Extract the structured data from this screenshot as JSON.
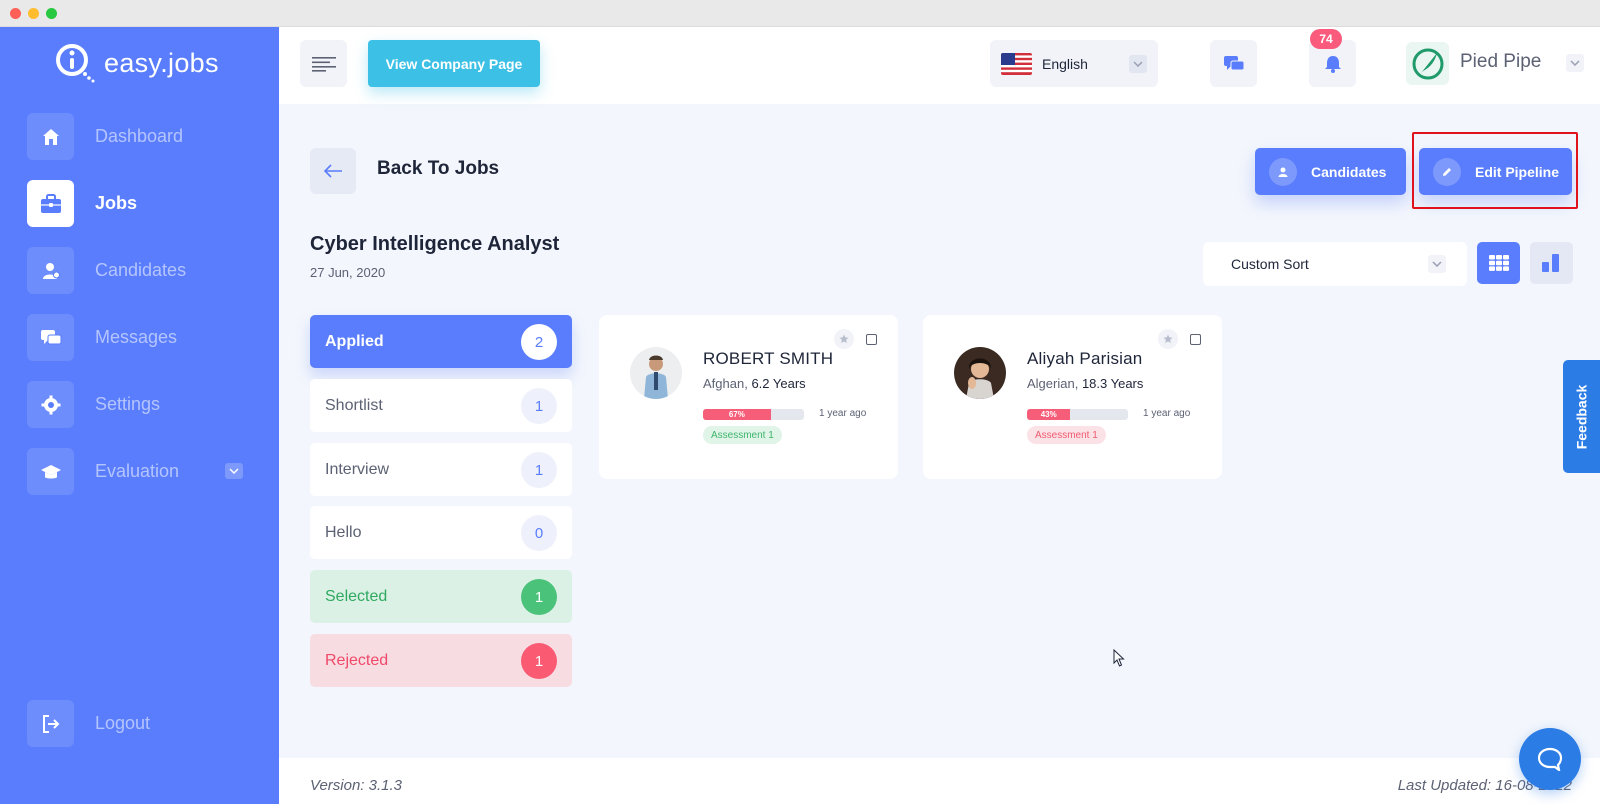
{
  "brand": {
    "name": "easy.jobs"
  },
  "sidebar": {
    "items": [
      {
        "label": "Dashboard",
        "icon": "home-icon"
      },
      {
        "label": "Jobs",
        "icon": "briefcase-icon",
        "active": true
      },
      {
        "label": "Candidates",
        "icon": "user-icon"
      },
      {
        "label": "Messages",
        "icon": "chat-icon"
      },
      {
        "label": "Settings",
        "icon": "gear-icon"
      },
      {
        "label": "Evaluation",
        "icon": "graduation-cap-icon"
      }
    ],
    "logout": "Logout"
  },
  "topbar": {
    "view_company_label": "View Company Page",
    "language": "English",
    "notification_count": "74",
    "company_name": "Pied Pipe"
  },
  "header": {
    "back_label": "Back To Jobs",
    "candidates_label": "Candidates",
    "edit_pipeline_label": "Edit Pipeline"
  },
  "job": {
    "title": "Cyber Intelligence Analyst",
    "date": "27 Jun, 2020"
  },
  "sort": {
    "selected": "Custom Sort"
  },
  "stages": [
    {
      "label": "Applied",
      "count": "2"
    },
    {
      "label": "Shortlist",
      "count": "1"
    },
    {
      "label": "Interview",
      "count": "1"
    },
    {
      "label": "Hello",
      "count": "0"
    },
    {
      "label": "Selected",
      "count": "1"
    },
    {
      "label": "Rejected",
      "count": "1"
    }
  ],
  "candidates": [
    {
      "name": "ROBERT SMITH",
      "nationality": "Afghan,",
      "experience": "6.2 Years",
      "score": 67,
      "score_label": "67%",
      "ago": "1 year ago",
      "tag": "Assessment 1",
      "tag_status": "pass"
    },
    {
      "name": "Aliyah Parisian",
      "nationality": "Algerian,",
      "experience": "18.3 Years",
      "score": 43,
      "score_label": "43%",
      "ago": "1 year ago",
      "tag": "Assessment 1",
      "tag_status": "fail"
    }
  ],
  "feedback_label": "Feedback",
  "footer": {
    "version": "Version: 3.1.3",
    "last_updated": "Last Updated: 16-08-2022"
  },
  "colors": {
    "primary": "#597dfc",
    "accent_cyan": "#3cc0e5",
    "success": "#4bc27a",
    "danger": "#fa5a72",
    "feedback_blue": "#2c7ce5"
  }
}
